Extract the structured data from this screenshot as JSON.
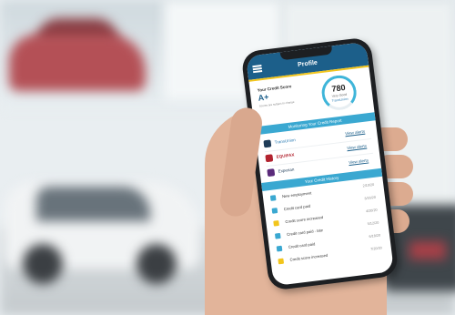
{
  "app": {
    "title": "Profile"
  },
  "credit": {
    "label": "Your Credit Score",
    "grade": "A+",
    "note": "Scores are subject to change",
    "score": "780",
    "rating": "Very Good",
    "brand": "TransUnion"
  },
  "monitoring": {
    "heading": "Monitoring Your Credit Report",
    "bureaus": [
      {
        "name": "TransUnion",
        "link": "View alerts",
        "color": "#2a7bb3"
      },
      {
        "name": "EQUIFAX",
        "link": "View alerts",
        "color": "#b2232f"
      },
      {
        "name": "Experian",
        "link": "View alerts",
        "color": "#1f3c58"
      }
    ]
  },
  "history": {
    "heading": "Your Credit History",
    "items": [
      {
        "icon": "briefcase-icon",
        "text": "New employment",
        "date": "2/10/20",
        "color": "#3aa8d1"
      },
      {
        "icon": "card-icon",
        "text": "Credit card paid",
        "date": "3/16/20",
        "color": "#3aa8d1"
      },
      {
        "icon": "chart-icon",
        "text": "Credit score increased",
        "date": "4/20/20",
        "color": "#f2c51c"
      },
      {
        "icon": "card-icon",
        "text": "Credit card paid - late",
        "date": "5/12/20",
        "color": "#3aa8d1"
      },
      {
        "icon": "card-icon",
        "text": "Credit card paid",
        "date": "6/18/20",
        "color": "#3aa8d1"
      },
      {
        "icon": "chart-icon",
        "text": "Credit score increased",
        "date": "7/20/20",
        "color": "#f2c51c"
      }
    ]
  }
}
